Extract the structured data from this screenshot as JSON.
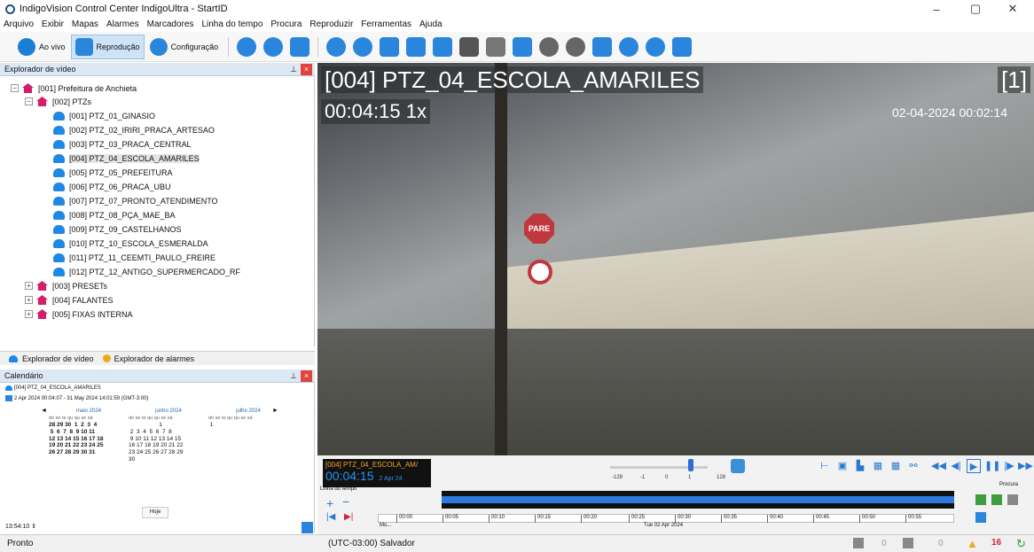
{
  "window": {
    "title": "IndigoVision Control Center IndigoUltra - StartID",
    "minimize": "–",
    "restore": "▢",
    "close": "✕"
  },
  "menu": [
    "Arquivo",
    "Exibir",
    "Mapas",
    "Alarmes",
    "Marcadores",
    "Linha do tempo",
    "Procura",
    "Reproduzir",
    "Ferramentas",
    "Ajuda"
  ],
  "toolbar": {
    "live": "Ao vivo",
    "playback": "Reprodução",
    "config": "Configuração"
  },
  "explorer": {
    "title": "Explorador de vídeo",
    "root": "[001] Prefeitura de Anchieta",
    "group": "[002] PTZs",
    "cameras": [
      "[001] PTZ_01_GINASIO",
      "[002] PTZ_02_IRIRI_PRACA_ARTESAO",
      "[003] PTZ_03_PRACA_CENTRAL",
      "[004] PTZ_04_ESCOLA_AMARILES",
      "[005] PTZ_05_PREFEITURA",
      "[006] PTZ_06_PRACA_UBU",
      "[007] PTZ_07_PRONTO_ATENDIMENTO",
      "[008] PTZ_08_PÇA_MAE_BA",
      "[009] PTZ_09_CASTELHANOS",
      "[010] PTZ_10_ESCOLA_ESMERALDA",
      "[011] PTZ_11_CEEMTI_PAULO_FREIRE",
      "[012] PTZ_12_ANTIGO_SUPERMERCADO_RF"
    ],
    "others": [
      "[003] PRESETs",
      "[004] FALANTES",
      "[005] FIXAS INTERNA"
    ]
  },
  "tabs": {
    "video": "Explorador de vídeo",
    "alarms": "Explorador de alarmes"
  },
  "calendar": {
    "title": "Calendário",
    "camera": "[004] PTZ_04_ESCOLA_AMARILES",
    "range": "2 Apr 2024 00:04:07 - 31 May 2024 14:01:59 (GMT-3:00)",
    "months": [
      "maio 2024",
      "junho 2024",
      "julho 2024"
    ],
    "weekdays": "do se te qu qu se sá",
    "may": "28 29 30  1  2  3  4\n 5  6  7  8  9 10 11\n12 13 14 15 16 17 18\n19 20 21 22 23 24 25\n26 27 28 29 30 31",
    "june": "                   1\n 2  3  4  5  6  7  8\n 9 10 11 12 13 14 15\n16 17 18 19 20 21 22\n23 24 25 26 27 28 29\n30",
    "july": " 1",
    "today": "Hoje",
    "time": "13:54:10"
  },
  "video": {
    "title": "[004] PTZ_04_ESCOLA_AMARILES",
    "time": "00:04:15 1x",
    "index": "[1]",
    "datetime": "02-04-2024 00:02:14",
    "sign": "PARE"
  },
  "controls": {
    "cam": "[004] PTZ_04_ESCOLA_AM/",
    "time": "00:04:15",
    "date": "2 Apr 24",
    "speeds": [
      "-128",
      "-1",
      "0",
      "1",
      "128"
    ],
    "timeline_label": "Linha do tempo",
    "ticks": [
      "00:00",
      "00:05",
      "00:10",
      "00:15",
      "00:20",
      "00:25",
      "00:30",
      "00:35",
      "00:40",
      "00:45",
      "00:50",
      "00:55"
    ],
    "tick_date": "Tue 02 Apr 2024",
    "mo": "Mo...",
    "search": "Procura"
  },
  "status": {
    "left": "Pronto",
    "tz": "(UTC-03:00) Salvador",
    "c1": "0",
    "c2": "0",
    "alarms": "16"
  }
}
